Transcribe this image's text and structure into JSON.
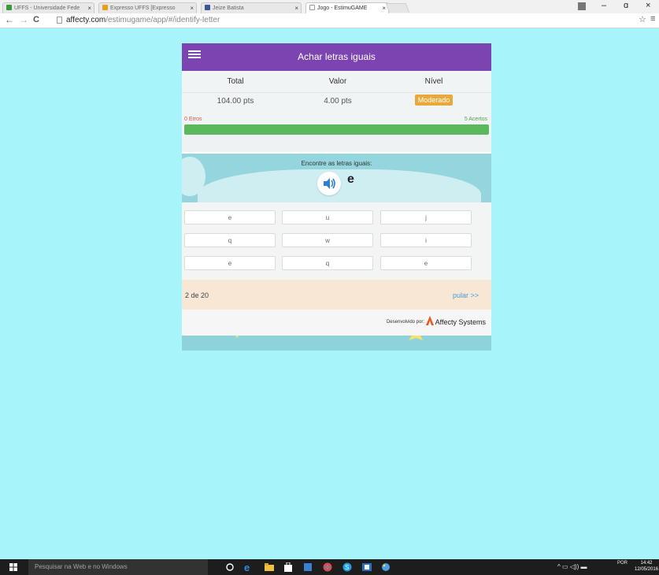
{
  "browser": {
    "tabs": [
      {
        "label": "UFFS - Universidade Fede",
        "close": "×"
      },
      {
        "label": "Expresso UFFS [Expresso",
        "close": "×"
      },
      {
        "label": "Jeize Batista",
        "close": "×"
      },
      {
        "label": "Jogo - EstimuGAME",
        "close": "×"
      }
    ],
    "url_domain": "affecty.com",
    "url_path": "/estimugame/app/#/identify-letter",
    "nav_back": "←",
    "nav_forward": "→",
    "nav_reload": "C",
    "minimize": "–",
    "maximize": "ɑ",
    "close": "×",
    "star": "☆",
    "menu": "≡"
  },
  "app": {
    "title": "Achar letras iguais",
    "scoreboard": {
      "headers": [
        "Total",
        "Valor",
        "Nível"
      ],
      "total": "104.00 pts",
      "value": "4.00 pts",
      "level": "Moderado"
    },
    "errors_label": "0 Erros",
    "hits_label": "5 Acertos",
    "progress": 1.0,
    "prompt": "Encontre as letras iguais:",
    "target_letter": "e",
    "letters": [
      [
        "e",
        "u",
        "j"
      ],
      [
        "q",
        "w",
        "i"
      ],
      [
        "e",
        "q",
        "e"
      ]
    ],
    "page_count": "2 de 20",
    "skip_label": "pular >>",
    "dev_label": "Desenvolvido por:",
    "dev_name": "Affecty Systems"
  },
  "taskbar": {
    "search_placeholder": "Pesquisar na Web e no Windows",
    "lang": "POR",
    "time": "14:42",
    "date": "12/05/2016"
  },
  "colors": {
    "page_bg": "#a7f4fb",
    "header_purple": "#7b44b0",
    "progress_green": "#5cb85c",
    "badge_orange": "#e8a93a"
  }
}
